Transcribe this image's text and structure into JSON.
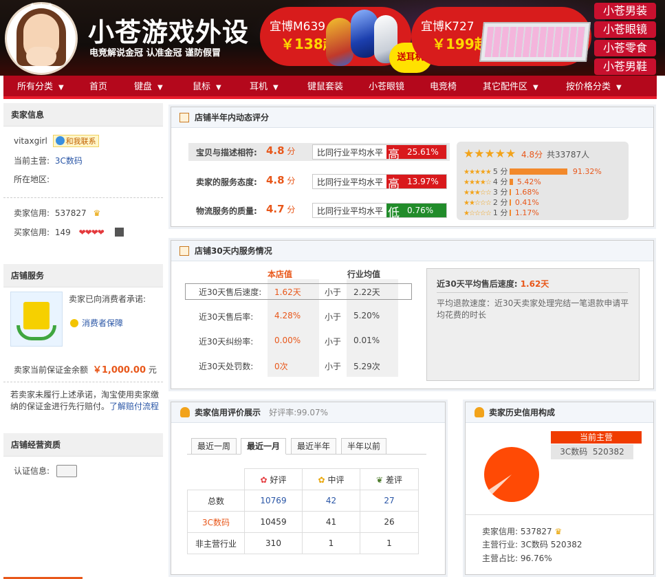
{
  "banner": {
    "shop_name": "小苍游戏外设",
    "slogan": "电竞解说金冠 认准金冠 谨防假冒",
    "promo1": {
      "name": "宜博M639",
      "price": "￥138起"
    },
    "promo2": {
      "name": "宜博K727",
      "price": "￥199起"
    },
    "burst": "送耳机",
    "side_tags": [
      "小苍男装",
      "小苍眼镜",
      "小苍零食",
      "小苍男鞋"
    ]
  },
  "nav": {
    "items": [
      "所有分类",
      "首页",
      "键盘",
      "鼠标",
      "耳机",
      "键鼠套装",
      "小苍眼镜",
      "电竞椅",
      "其它配件区",
      "按价格分类"
    ]
  },
  "seller": {
    "title": "卖家信息",
    "name": "vitaxgirl",
    "contact": "和我联系",
    "main_label": "当前主营:",
    "main_value": "3C数码",
    "area_label": "所在地区:",
    "seller_credit_label": "卖家信用:",
    "seller_credit_value": "537827",
    "buyer_credit_label": "买家信用:",
    "buyer_credit_value": "149"
  },
  "service": {
    "title": "店铺服务",
    "promise": "卖家已向消费者承诺:",
    "guarantee": "消费者保障",
    "deposit_label": "卖家当前保证金余额",
    "deposit_value": "￥1,000.00",
    "deposit_unit": "元",
    "note": "若卖家未履行上述承诺，淘宝使用卖家缴纳的保证金进行先行赔付。",
    "note_link": "了解赔付流程"
  },
  "qualification": {
    "title": "店铺经营资质",
    "cert_label": "认证信息:"
  },
  "dsr": {
    "title": "店铺半年内动态评分",
    "compare_label": "比同行业平均水平",
    "unit": "分",
    "rows": [
      {
        "label": "宝贝与描述相符:",
        "score": "4.8",
        "level": "高",
        "pct": "25.61%",
        "color": "#d9191c"
      },
      {
        "label": "卖家的服务态度:",
        "score": "4.8",
        "level": "高",
        "pct": "13.97%",
        "color": "#d9191c"
      },
      {
        "label": "物流服务的质量:",
        "score": "4.7",
        "level": "低",
        "pct": "0.76%",
        "color": "#218c2a"
      }
    ],
    "summary_score": "4.8分",
    "summary_count": "共33787人",
    "dist": [
      {
        "label": "5 分",
        "pct": "91.32%",
        "frac": 0.9132
      },
      {
        "label": "4 分",
        "pct": "5.42%",
        "frac": 0.0542
      },
      {
        "label": "3 分",
        "pct": "1.68%",
        "frac": 0.0168
      },
      {
        "label": "2 分",
        "pct": "0.41%",
        "frac": 0.0041
      },
      {
        "label": "1 分",
        "pct": "1.17%",
        "frac": 0.0117
      }
    ]
  },
  "service30": {
    "title": "店铺30天内服务情况",
    "col_shop": "本店值",
    "col_avg": "行业均值",
    "less": "小于",
    "rows": [
      {
        "label": "近30天售后速度:",
        "shop": "1.62天",
        "avg": "2.22天"
      },
      {
        "label": "近30天售后率:",
        "shop": "4.28%",
        "avg": "5.20%"
      },
      {
        "label": "近30天纠纷率:",
        "shop": "0.00%",
        "avg": "0.01%"
      },
      {
        "label": "近30天处罚数:",
        "shop": "0次",
        "avg": "5.29次"
      }
    ],
    "detail_title": "近30天平均售后速度:",
    "detail_value": "1.62天",
    "detail_text": "平均退款速度：近30天卖家处理完结一笔退款申请平均花费的时长"
  },
  "credit": {
    "title": "卖家信用评价展示",
    "good_rate_label": "好评率:",
    "good_rate": "99.07%",
    "tabs": [
      "最近一周",
      "最近一月",
      "最近半年",
      "半年以前"
    ],
    "active_tab": 1,
    "headers": [
      "好评",
      "中评",
      "差评"
    ],
    "rows": [
      {
        "label": "总数",
        "vals": [
          "10769",
          "42",
          "27"
        ]
      },
      {
        "label": "3C数码",
        "vals": [
          "10459",
          "41",
          "26"
        ]
      },
      {
        "label": "非主营行业",
        "vals": [
          "310",
          "1",
          "1"
        ]
      }
    ]
  },
  "history": {
    "title": "卖家历史信用构成",
    "tag": "当前主营",
    "tag_value": "3C数码  520382",
    "pie_main_frac": 0.9676,
    "credit_label": "卖家信用:",
    "credit_value": "537827",
    "main_label": "主营行业:",
    "main_value": "3C数码 520382",
    "share_label": "主营占比:",
    "share_value": "96.76%"
  },
  "colors": {
    "nav": "#b4081c",
    "accent": "#e8571a",
    "link": "#2a56a6"
  }
}
